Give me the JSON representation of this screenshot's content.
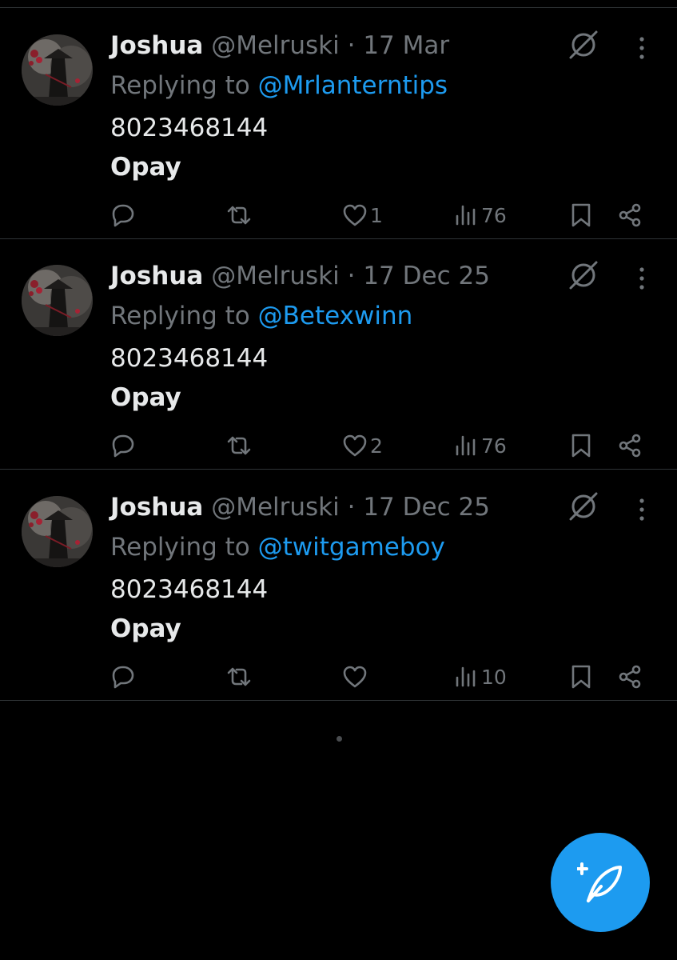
{
  "tweets": [
    {
      "name": "Joshua",
      "handle": "@Melruski",
      "sep": "·",
      "date": "17 Mar",
      "replying_prefix": "Replying to",
      "replying_to": "@Mrlanterntips",
      "line1": "8023468144",
      "line2": "Opay",
      "likes": "1",
      "views": "76"
    },
    {
      "name": "Joshua",
      "handle": "@Melruski",
      "sep": "·",
      "date": "17 Dec 25",
      "replying_prefix": "Replying to",
      "replying_to": "@Betexwinn",
      "line1": "8023468144",
      "line2": "Opay",
      "likes": "2",
      "views": "76"
    },
    {
      "name": "Joshua",
      "handle": "@Melruski",
      "sep": "·",
      "date": "17 Dec 25",
      "replying_prefix": "Replying to",
      "replying_to": "@twitgameboy",
      "line1": "8023468144",
      "line2": "Opay",
      "likes": "",
      "views": "10"
    }
  ],
  "icons": {
    "reply": "reply-icon",
    "retweet": "retweet-icon",
    "like": "heart-icon",
    "views": "views-icon",
    "bookmark": "bookmark-icon",
    "share": "share-icon",
    "grok": "grok-icon",
    "more": "more-icon",
    "compose": "compose-icon"
  },
  "colors": {
    "background": "#000000",
    "text": "#e7e9ea",
    "muted": "#71767b",
    "accent": "#1d9bf0",
    "divider": "#2f3336"
  }
}
